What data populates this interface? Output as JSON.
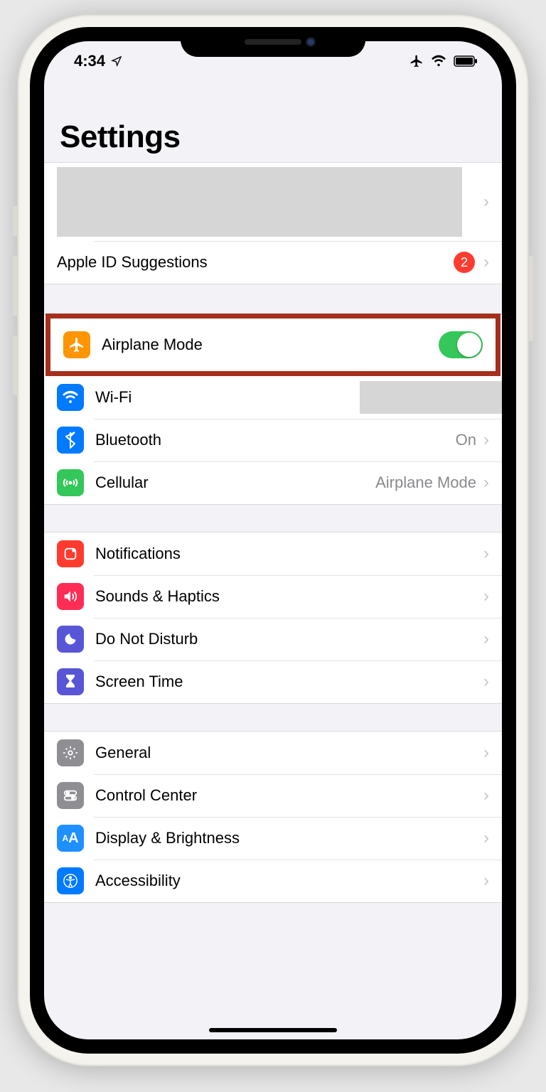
{
  "status_bar": {
    "time": "4:34",
    "icons": [
      "location-arrow-icon",
      "airplane-icon",
      "wifi-icon",
      "battery-icon"
    ]
  },
  "header": {
    "title": "Settings"
  },
  "groups": {
    "account": {
      "apple_id_row": {
        "label": "Apple ID Suggestions",
        "badge": "2"
      }
    },
    "connectivity": {
      "airplane": {
        "label": "Airplane Mode",
        "on": true
      },
      "wifi": {
        "label": "Wi-Fi",
        "value": ""
      },
      "bluetooth": {
        "label": "Bluetooth",
        "value": "On"
      },
      "cellular": {
        "label": "Cellular",
        "value": "Airplane Mode"
      }
    },
    "alerts": {
      "notifications": {
        "label": "Notifications"
      },
      "sounds": {
        "label": "Sounds & Haptics"
      },
      "dnd": {
        "label": "Do Not Disturb"
      },
      "screentime": {
        "label": "Screen Time"
      }
    },
    "system": {
      "general": {
        "label": "General"
      },
      "controlcenter": {
        "label": "Control Center"
      },
      "display": {
        "label": "Display & Brightness"
      },
      "accessibility": {
        "label": "Accessibility"
      }
    }
  },
  "colors": {
    "orange": "#ff9500",
    "blue": "#007aff",
    "green": "#34c759",
    "red": "#ff3b30",
    "pink": "#ff2d55",
    "indigo": "#5856d6",
    "gray": "#8e8e93",
    "lightblue": "#1e90ff"
  },
  "highlight": "airplane"
}
